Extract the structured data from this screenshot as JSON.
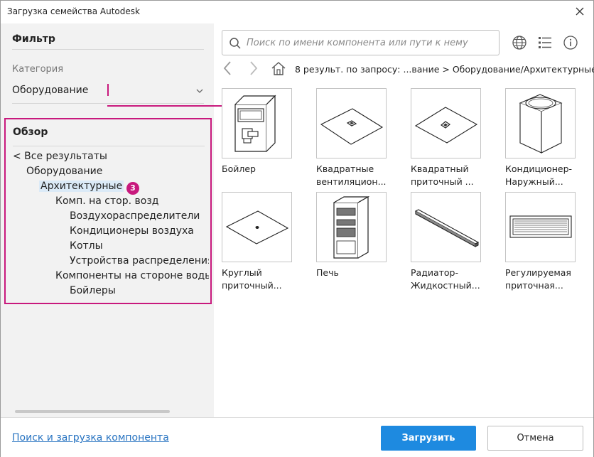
{
  "window": {
    "title": "Загрузка семейства Autodesk"
  },
  "filter": {
    "title": "Фильтр",
    "category_label": "Категория",
    "category_value": "Оборудование"
  },
  "browse": {
    "title": "Обзор",
    "tree": [
      "< Все результаты",
      "Оборудование",
      "Архитектурные",
      "Комп. на стор. возд",
      "Воздухораспределители",
      "Кондиционеры воздуха",
      "Котлы",
      "Устройства распределения",
      "Компоненты на стороне воды",
      "Бойлеры"
    ],
    "callout_number": "3"
  },
  "search": {
    "placeholder": "Поиск по имени компонента или пути к нему"
  },
  "results": {
    "summary": "8 результ. по запросу:  ...вание > Оборудование/Архитектурные"
  },
  "items": [
    {
      "line1": "Бойлер",
      "line2": ""
    },
    {
      "line1": "Квадратные",
      "line2": "вентиляцион..."
    },
    {
      "line1": "Квадратный",
      "line2": "приточный ..."
    },
    {
      "line1": "Кондиционер-",
      "line2": "Наружный..."
    },
    {
      "line1": "Круглый",
      "line2": "приточный..."
    },
    {
      "line1": "Печь",
      "line2": ""
    },
    {
      "line1": "Радиатор-",
      "line2": "Жидкостный..."
    },
    {
      "line1": "Регулируемая",
      "line2": "приточная..."
    }
  ],
  "footer": {
    "link": "Поиск и загрузка компонента",
    "load": "Загрузить",
    "cancel": "Отмена"
  },
  "colors": {
    "accent": "#1e8ae0",
    "callout": "#c8197d",
    "link": "#2a75c2"
  }
}
